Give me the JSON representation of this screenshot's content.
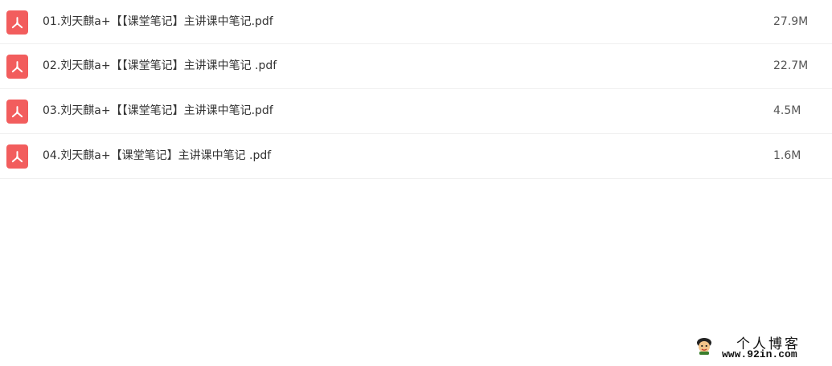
{
  "files": [
    {
      "name": "01.刘天麒a+【【课堂笔记】主讲课中笔记.pdf",
      "size": "27.9M",
      "icon": "pdf-icon"
    },
    {
      "name": "02.刘天麒a+【【课堂笔记】主讲课中笔记 .pdf",
      "size": "22.7M",
      "icon": "pdf-icon"
    },
    {
      "name": "03.刘天麒a+【【课堂笔记】主讲课中笔记.pdf",
      "size": "4.5M",
      "icon": "pdf-icon"
    },
    {
      "name": "04.刘天麒a+【课堂笔记】主讲课中笔记 .pdf",
      "size": "1.6M",
      "icon": "pdf-icon"
    }
  ],
  "watermark": {
    "title": "个人博客",
    "url": "www.92in.com"
  },
  "colors": {
    "pdf_icon_bg": "#f25d5d",
    "row_divider": "#f0f0f0",
    "text": "#333333"
  }
}
